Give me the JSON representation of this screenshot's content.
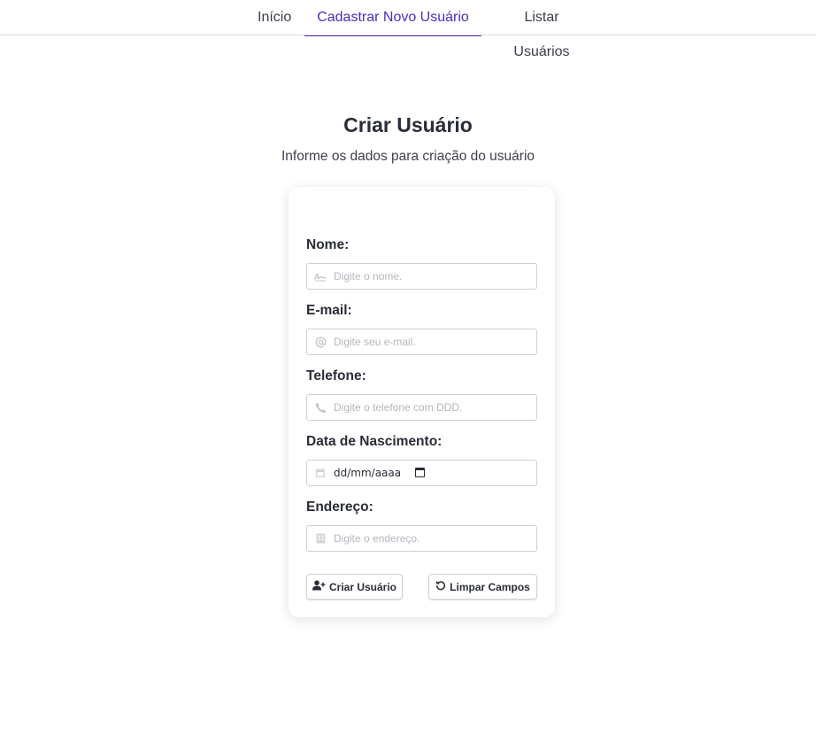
{
  "nav": {
    "tabs": [
      {
        "label": "Início"
      },
      {
        "label": "Cadastrar Novo Usuário"
      },
      {
        "label": "Listar Usuários"
      }
    ],
    "active_tab": "Cadastrar Novo Usuário",
    "accent_color": "#4a2fc4"
  },
  "page": {
    "title": "Criar Usuário",
    "subtitle": "Informe os dados para criação do usuário"
  },
  "form": {
    "name": {
      "label": "Nome:",
      "placeholder": "Digite o nome.",
      "icon": "signature-icon"
    },
    "email": {
      "label": "E-mail:",
      "placeholder": "Digite seu e-mail.",
      "icon": "at-icon"
    },
    "phone": {
      "label": "Telefone:",
      "placeholder": "Digite o telefone com DDD.",
      "icon": "phone-icon"
    },
    "birthdate": {
      "label": "Data de Nascimento:",
      "value": "dd/mm/aaaa",
      "icon": "calendar-icon"
    },
    "address": {
      "label": "Endereço:",
      "placeholder": "Digite o endereço.",
      "icon": "building-icon"
    }
  },
  "actions": {
    "create_label": "Criar Usuário",
    "create_icon": "user-plus-icon",
    "clear_label": "Limpar Campos",
    "clear_icon": "rotate-left-icon"
  }
}
